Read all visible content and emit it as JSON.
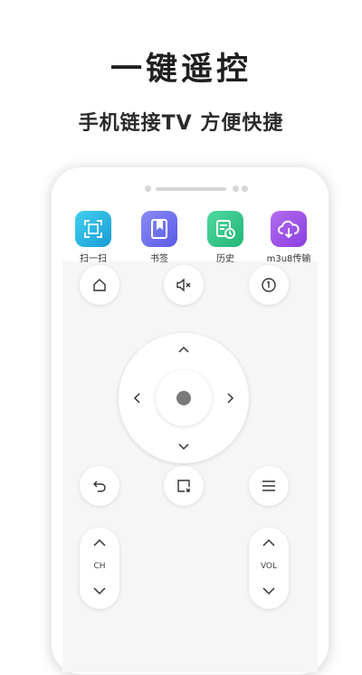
{
  "headline": "一键遥控",
  "subline": "手机链接TV 方便快捷",
  "apps": [
    {
      "label": "扫一扫",
      "icon": "scan-icon",
      "color": "#2fb3e0"
    },
    {
      "label": "书签",
      "icon": "bookmark-icon",
      "color": "#6f6ff0"
    },
    {
      "label": "历史",
      "icon": "history-icon",
      "color": "#35c58a"
    },
    {
      "label": "m3u8传输",
      "icon": "upload-cloud-icon",
      "color": "#9b4fe6"
    }
  ],
  "controls": {
    "home": "home-icon",
    "mute": "mute-icon",
    "power": "power-icon",
    "back": "back-icon",
    "source": "source-icon",
    "menu": "menu-icon"
  },
  "channel_label": "CH",
  "volume_label": "VOL"
}
